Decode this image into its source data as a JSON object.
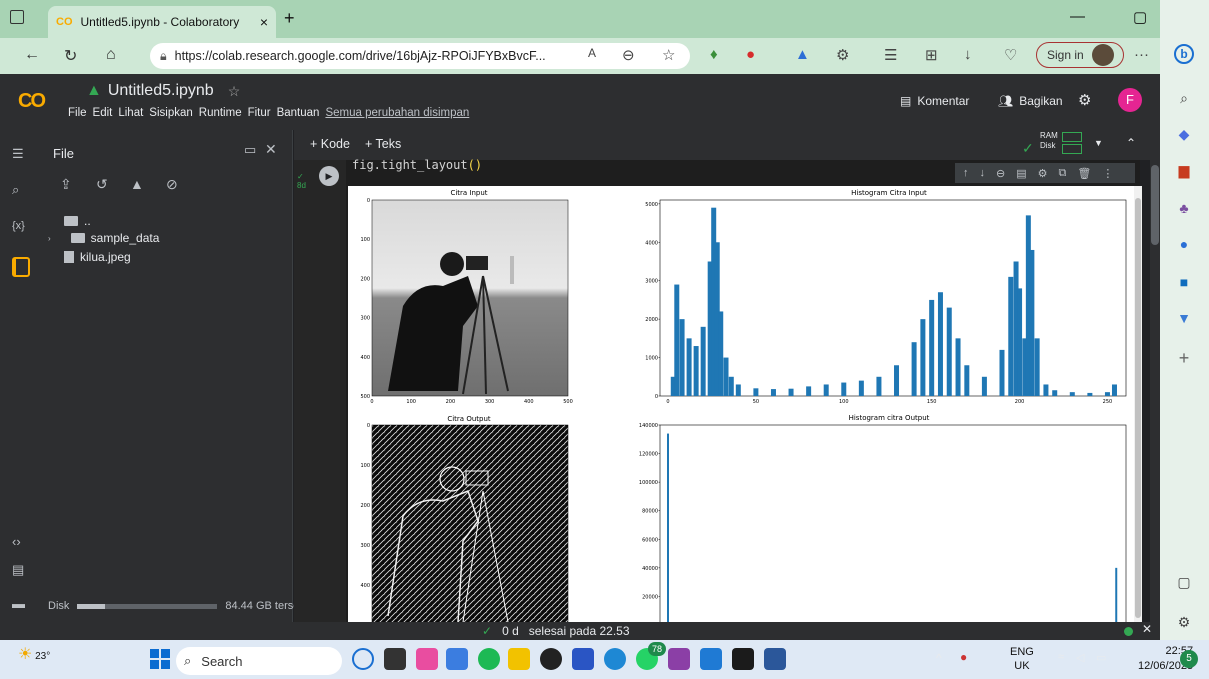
{
  "browser": {
    "tab_logo": "CO",
    "tab_title": "Untitled5.ipynb - Colaboratory",
    "tab_close": "×",
    "new_tab": "+",
    "url": "https://colab.research.google.com/drive/16bjAjz-RPOiJFYBxBvcF...",
    "sign_in": "Sign in",
    "more": "···"
  },
  "colab": {
    "logo": "CO",
    "notebook_title": "Untitled5.ipynb",
    "menu": [
      "File",
      "Edit",
      "Lihat",
      "Sisipkan",
      "Runtime",
      "Fitur",
      "Bantuan"
    ],
    "saved_status": "Semua perubahan disimpan",
    "comment_label": "Komentar",
    "share_label": "Bagikan",
    "user_initial": "F",
    "add_code": "+ Kode",
    "add_text": "+ Teks",
    "ram_label": "RAM",
    "disk_label": "Disk"
  },
  "file_panel": {
    "title": "File",
    "items": [
      {
        "name": "..",
        "type": "folder"
      },
      {
        "name": "sample_data",
        "type": "folder"
      },
      {
        "name": "kilua.jpeg",
        "type": "file"
      }
    ],
    "disk_label": "Disk",
    "disk_free": "84.44 GB tersedia",
    "disk_used_fraction": 0.2
  },
  "cell": {
    "exec_time": "8d",
    "code_text": "fig.tight_layout",
    "code_paren": "()"
  },
  "status": {
    "duration": "0 d",
    "message": "selesai pada 22.53"
  },
  "taskbar": {
    "weather": "23°",
    "search_label": "Search",
    "badge": "78",
    "lang_line1": "ENG",
    "lang_line2": "UK",
    "time": "22:57",
    "date": "12/06/2023",
    "notif_count": "5"
  },
  "chart_data": [
    {
      "type": "image",
      "title": "Citra Input",
      "x_ticks": [
        "0",
        "100",
        "200",
        "300",
        "400",
        "500"
      ],
      "y_ticks": [
        "0",
        "100",
        "200",
        "300",
        "400",
        "500"
      ]
    },
    {
      "type": "bar",
      "title": "Histogram Citra Input",
      "x_ticks": [
        "0",
        "50",
        "100",
        "150",
        "200",
        "250"
      ],
      "y_ticks": [
        "0",
        "1000",
        "2000",
        "3000",
        "4000",
        "5000"
      ],
      "xlim": [
        0,
        256
      ],
      "ylim": [
        0,
        5100
      ],
      "x": [
        3,
        5,
        8,
        12,
        16,
        20,
        24,
        26,
        28,
        30,
        33,
        36,
        40,
        50,
        60,
        70,
        80,
        90,
        100,
        110,
        120,
        130,
        140,
        145,
        150,
        155,
        160,
        165,
        170,
        180,
        190,
        195,
        198,
        200,
        203,
        205,
        207,
        210,
        215,
        220,
        230,
        240,
        250,
        254
      ],
      "values": [
        500,
        2900,
        2000,
        1500,
        1300,
        1800,
        3500,
        4900,
        4000,
        2200,
        1000,
        500,
        300,
        200,
        180,
        190,
        250,
        300,
        350,
        400,
        500,
        800,
        1400,
        2000,
        2500,
        2700,
        2300,
        1500,
        800,
        500,
        1200,
        3100,
        3500,
        2800,
        1500,
        4700,
        3800,
        1500,
        300,
        150,
        100,
        80,
        100,
        300
      ]
    },
    {
      "type": "image",
      "title": "Citra Output",
      "y_ticks": [
        "0",
        "100",
        "200",
        "300",
        "400",
        "500"
      ]
    },
    {
      "type": "bar",
      "title": "Histogram citra Output",
      "y_ticks": [
        "0",
        "20000",
        "40000",
        "60000",
        "80000",
        "100000",
        "120000",
        "140000"
      ],
      "xlim": [
        0,
        256
      ],
      "ylim": [
        0,
        140000
      ],
      "x": [
        0,
        255
      ],
      "values": [
        134000,
        40000
      ]
    }
  ]
}
